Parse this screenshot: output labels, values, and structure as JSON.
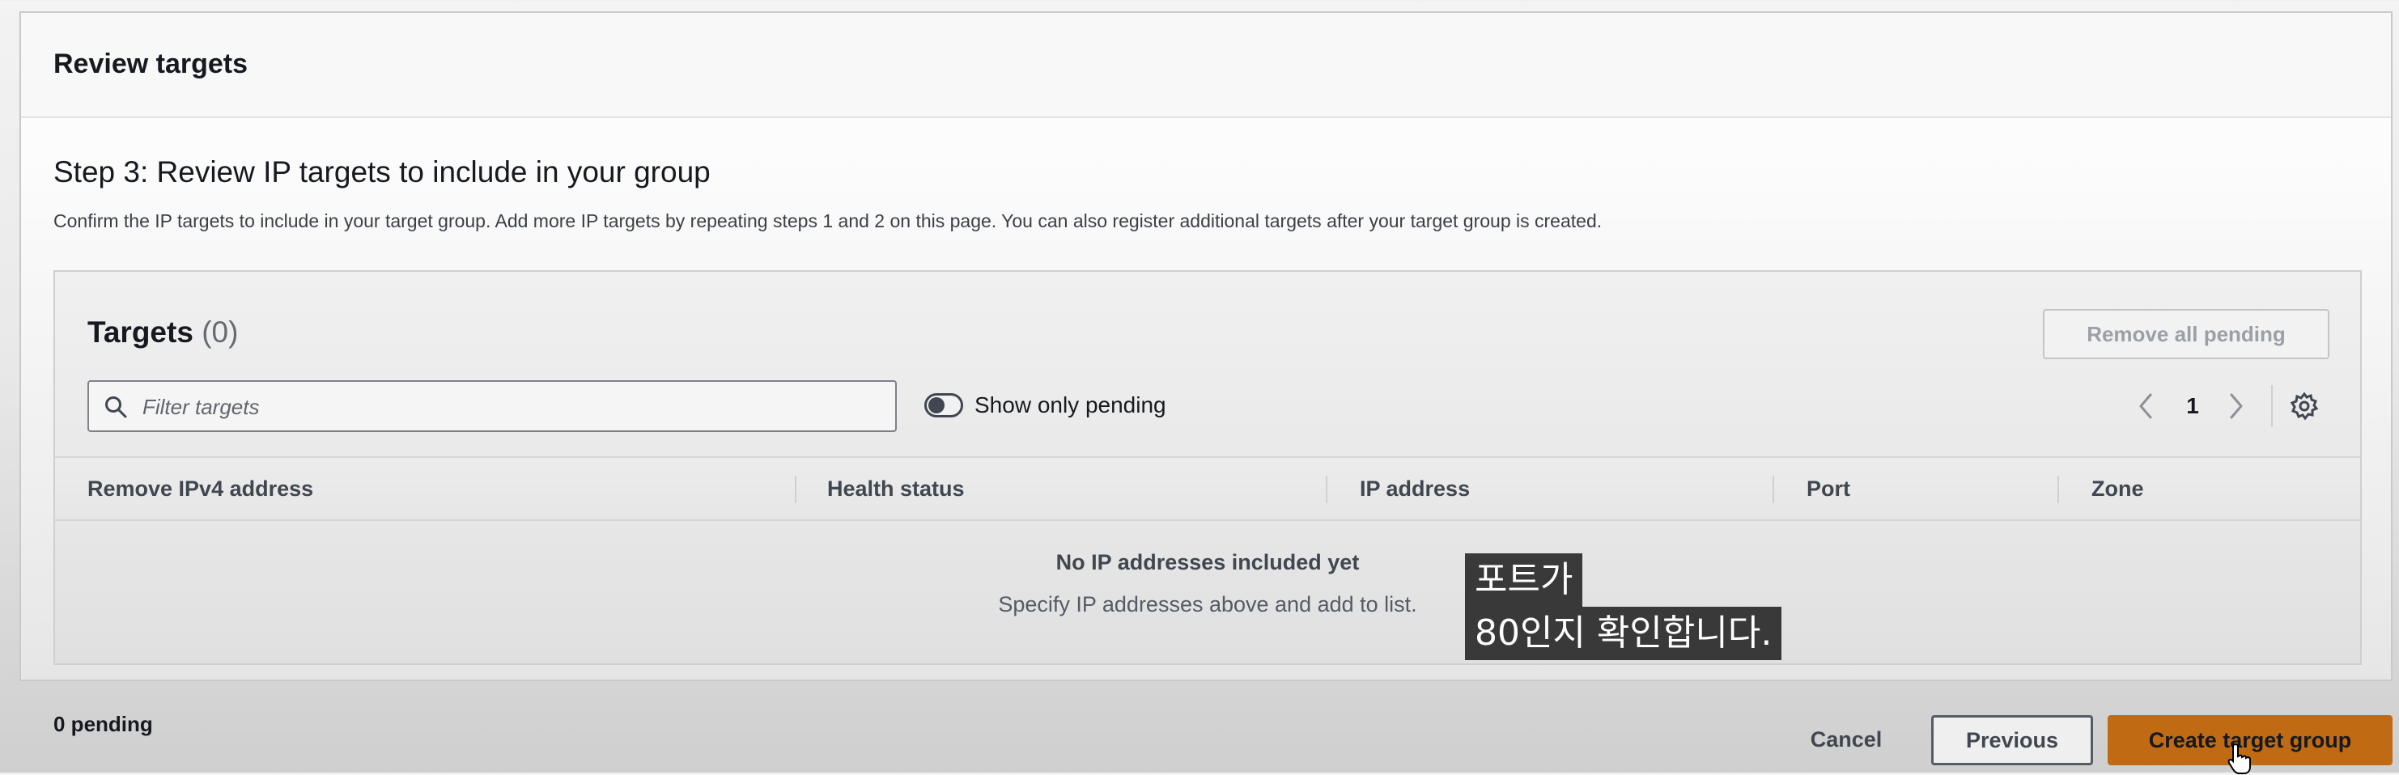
{
  "panel": {
    "title": "Review targets",
    "step_title": "Step 3: Review IP targets to include in your group",
    "step_description": "Confirm the IP targets to include in your target group. Add more IP targets by repeating steps 1 and 2 on this page. You can also register additional targets after your target group is created."
  },
  "targets": {
    "title": "Targets",
    "count": "(0)",
    "remove_all_label": "Remove all pending",
    "filter_placeholder": "Filter targets",
    "show_only_pending_label": "Show only pending",
    "show_only_pending_on": false,
    "page_number": "1",
    "columns": [
      "Remove IPv4 address",
      "Health status",
      "IP address",
      "Port",
      "Zone"
    ],
    "empty_title": "No IP addresses included yet",
    "empty_description": "Specify IP addresses above and add to list."
  },
  "caption": {
    "line1": "포트가",
    "line2": "80인지 확인합니다."
  },
  "footer": {
    "pending": "0 pending",
    "cancel_label": "Cancel",
    "previous_label": "Previous",
    "create_label": "Create target group"
  },
  "colors": {
    "primary_button": "#c06a14",
    "text_dark": "#16191f",
    "text_muted": "#545b64"
  },
  "icons": [
    "search-icon",
    "chevron-left-icon",
    "chevron-right-icon",
    "gear-icon",
    "hand-cursor-icon"
  ]
}
